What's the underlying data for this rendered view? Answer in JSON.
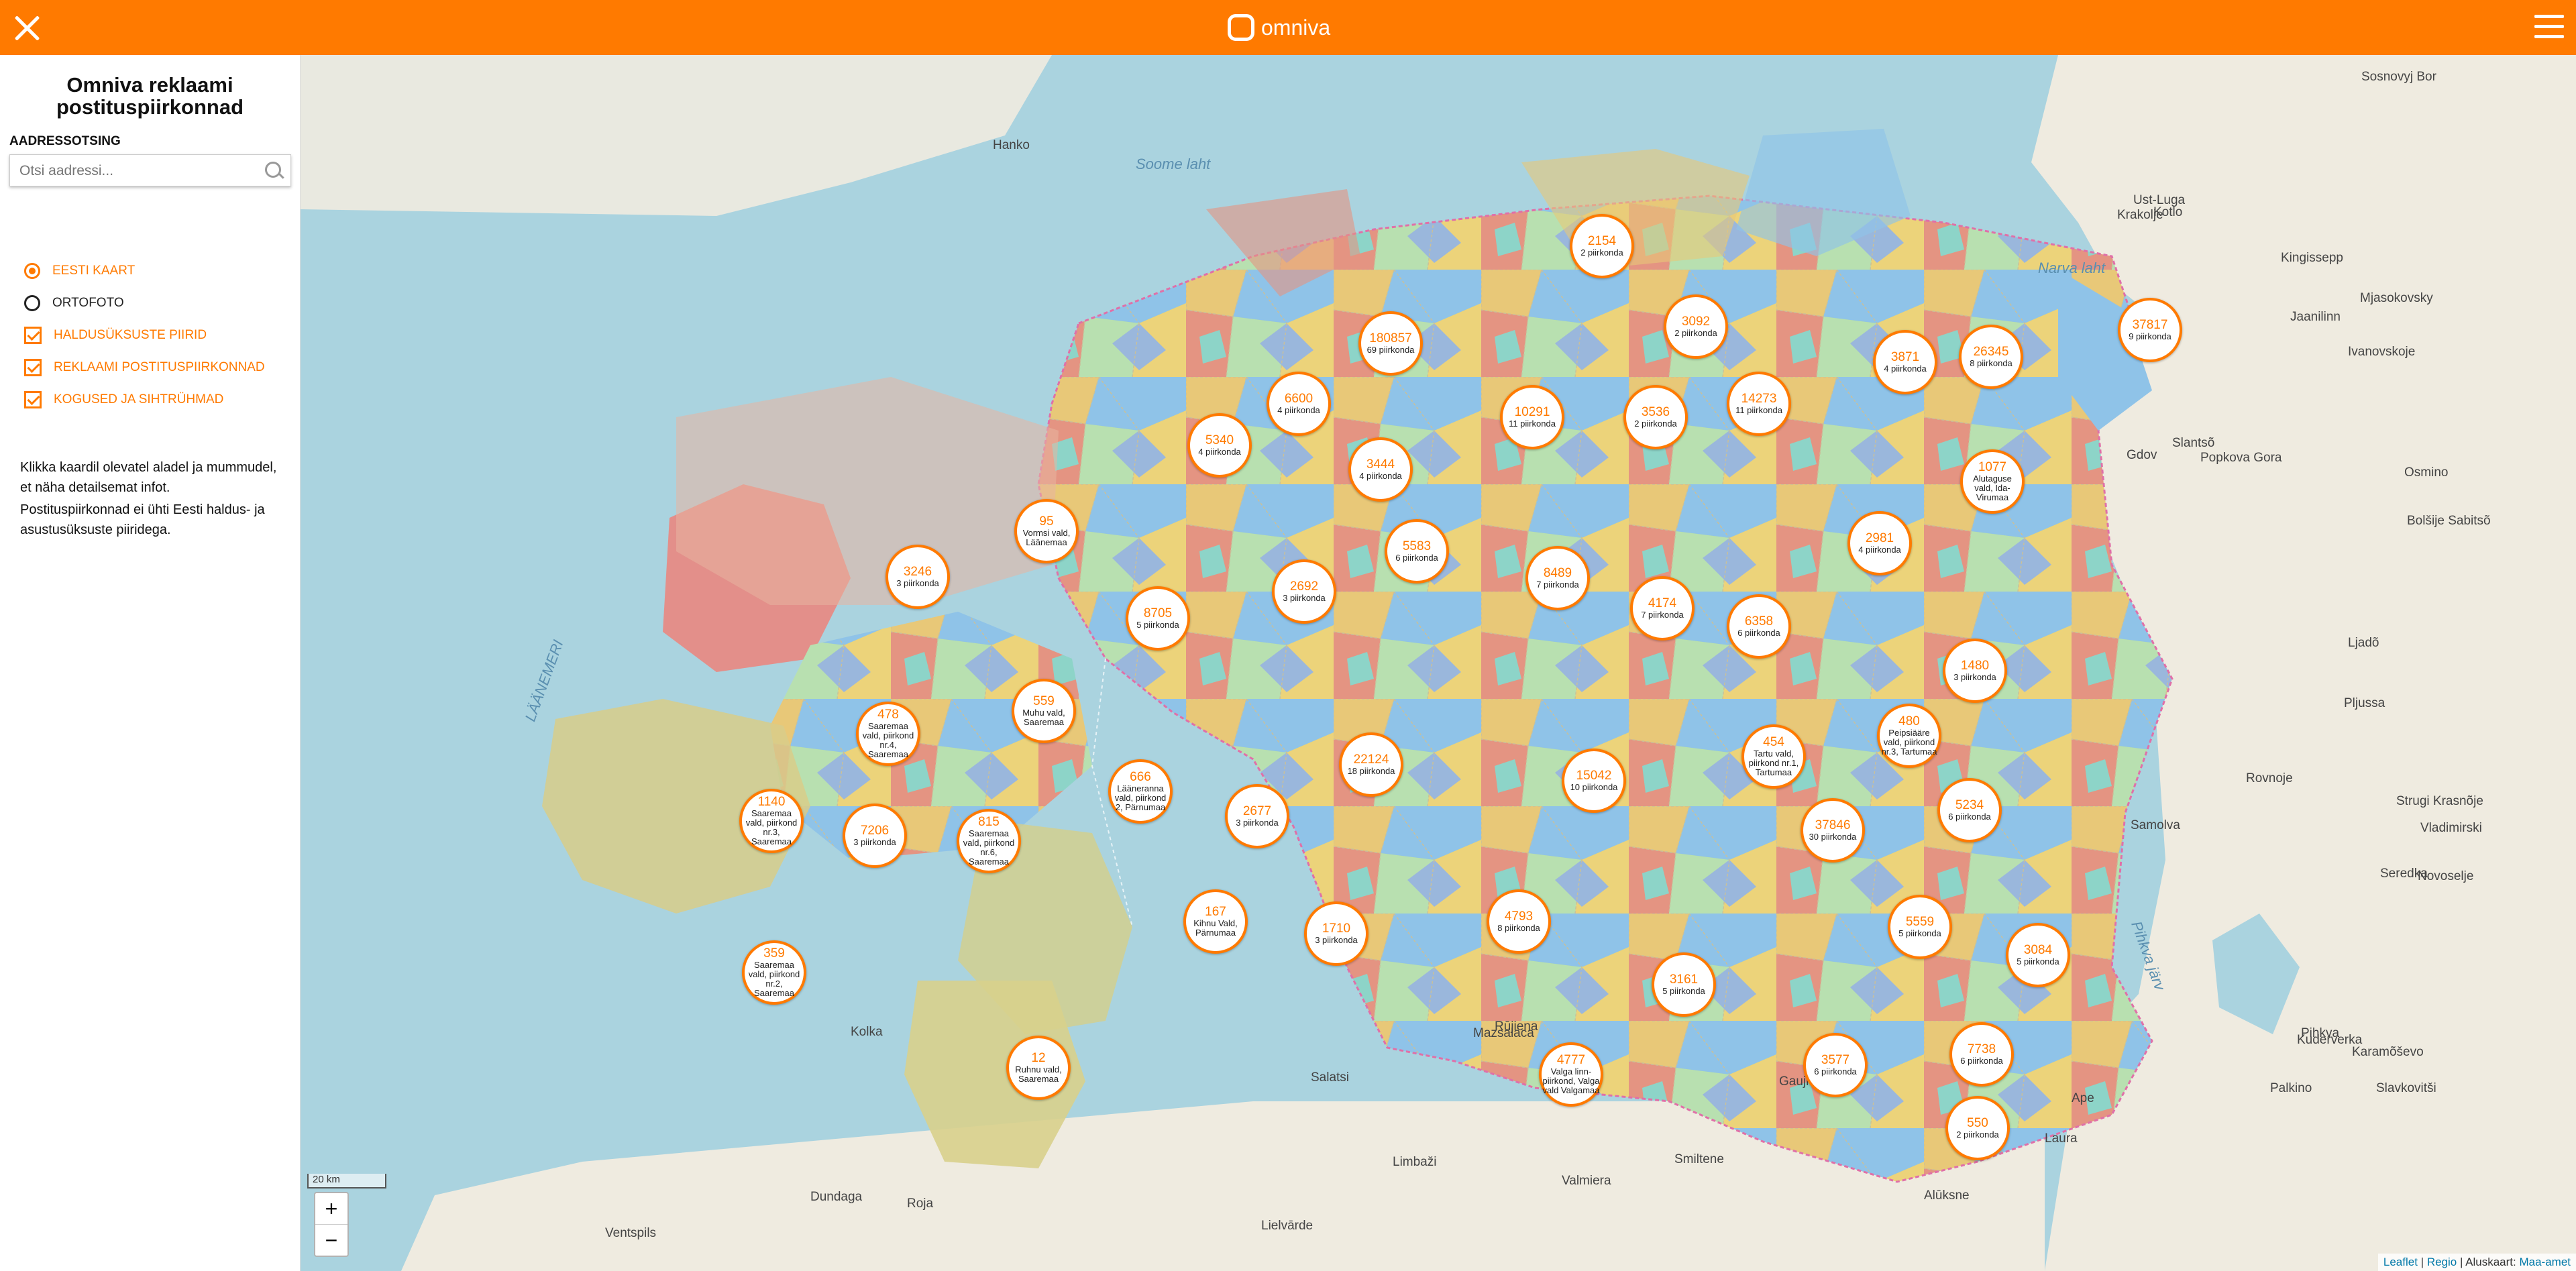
{
  "topbar": {
    "brand": "omniva",
    "accent": "#ff7a00",
    "close_icon": "close-icon",
    "menu_icon": "hamburger-menu-icon"
  },
  "sidebar": {
    "title": "Omniva reklaami postituspiirkonnad",
    "search_label": "AADRESSOTSING",
    "search_placeholder": "Otsi aadressi...",
    "options": [
      {
        "label": "EESTI KAART",
        "type": "radio",
        "checked": true
      },
      {
        "label": "ORTOFOTO",
        "type": "radio",
        "checked": false
      },
      {
        "label": "HALDUSÜKSUSTE PIIRID",
        "type": "checkbox",
        "checked": true
      },
      {
        "label": "REKLAAMI POSTITUSPIIRKONNAD",
        "type": "checkbox",
        "checked": true
      },
      {
        "label": "KOGUSED JA SIHTRÜHMAD",
        "type": "checkbox",
        "checked": true
      }
    ],
    "info1": "Klikka kaardil olevatel aladel ja mummudel, et näha detailsemat infot.",
    "info2": "Postituspiirkonnad ei ühti Eesti haldus- ja asustusüksuste piiridega."
  },
  "map": {
    "markers": [
      {
        "count": "2154",
        "label": "2 piirkonda"
      },
      {
        "count": "180857",
        "label": "69 piirkonda"
      },
      {
        "count": "3092",
        "label": "2 piirkonda"
      },
      {
        "count": "3871",
        "label": "4 piirkonda"
      },
      {
        "count": "26345",
        "label": "8 piirkonda"
      },
      {
        "count": "37817",
        "label": "9 piirkonda"
      },
      {
        "count": "6600",
        "label": "4 piirkonda"
      },
      {
        "count": "10291",
        "label": "11 piirkonda"
      },
      {
        "count": "3536",
        "label": "2 piirkonda"
      },
      {
        "count": "14273",
        "label": "11 piirkonda"
      },
      {
        "count": "5340",
        "label": "4 piirkonda"
      },
      {
        "count": "3444",
        "label": "4 piirkonda"
      },
      {
        "count": "1077",
        "label": "Alutaguse vald, Ida-Virumaa"
      },
      {
        "count": "95",
        "label": "Vormsi vald, Läänemaa"
      },
      {
        "count": "5583",
        "label": "6 piirkonda"
      },
      {
        "count": "2981",
        "label": "4 piirkonda"
      },
      {
        "count": "3246",
        "label": "3 piirkonda"
      },
      {
        "count": "8489",
        "label": "7 piirkonda"
      },
      {
        "count": "2692",
        "label": "3 piirkonda"
      },
      {
        "count": "4174",
        "label": "7 piirkonda"
      },
      {
        "count": "8705",
        "label": "5 piirkonda"
      },
      {
        "count": "6358",
        "label": "6 piirkonda"
      },
      {
        "count": "1480",
        "label": "3 piirkonda"
      },
      {
        "count": "559",
        "label": "Muhu vald, Saaremaa"
      },
      {
        "count": "478",
        "label": "Saaremaa vald, piirkond nr.4, Saaremaa"
      },
      {
        "count": "480",
        "label": "Peipsiääre vald, piirkond nr.3, Tartumaa"
      },
      {
        "count": "454",
        "label": "Tartu vald, piirkond nr.1, Tartumaa"
      },
      {
        "count": "22124",
        "label": "18 piirkonda"
      },
      {
        "count": "666",
        "label": "Lääneranna vald, piirkond 2, Pärnumaa"
      },
      {
        "count": "15042",
        "label": "10 piirkonda"
      },
      {
        "count": "1140",
        "label": "Saaremaa vald, piirkond nr.3, Saaremaa"
      },
      {
        "count": "2677",
        "label": "3 piirkonda"
      },
      {
        "count": "5234",
        "label": "6 piirkonda"
      },
      {
        "count": "7206",
        "label": "3 piirkonda"
      },
      {
        "count": "815",
        "label": "Saaremaa vald, piirkond nr.6, Saaremaa"
      },
      {
        "count": "37846",
        "label": "30 piirkonda"
      },
      {
        "count": "167",
        "label": "Kihnu Vald, Pärnumaa"
      },
      {
        "count": "4793",
        "label": "8 piirkonda"
      },
      {
        "count": "5559",
        "label": "5 piirkonda"
      },
      {
        "count": "1710",
        "label": "3 piirkonda"
      },
      {
        "count": "3084",
        "label": "5 piirkonda"
      },
      {
        "count": "359",
        "label": "Saaremaa vald, piirkond nr.2, Saaremaa"
      },
      {
        "count": "3161",
        "label": "5 piirkonda"
      },
      {
        "count": "12",
        "label": "Ruhnu vald, Saaremaa"
      },
      {
        "count": "7738",
        "label": "6 piirkonda"
      },
      {
        "count": "4777",
        "label": "Valga linn-piirkond, Valga vald Valgamaa"
      },
      {
        "count": "3577",
        "label": "6 piirkonda"
      },
      {
        "count": "550",
        "label": "2 piirkonda"
      }
    ],
    "places": [
      {
        "name": "Hanko"
      },
      {
        "name": "Sosnovyj Bor"
      },
      {
        "name": "Kotlo"
      },
      {
        "name": "Ust-Luga"
      },
      {
        "name": "Krakolje"
      },
      {
        "name": "Jaanilinn"
      },
      {
        "name": "Kingissepp"
      },
      {
        "name": "Mjasokovsky"
      },
      {
        "name": "Ivanovskoje"
      },
      {
        "name": "Slantsõ"
      },
      {
        "name": "Popkova Gora"
      },
      {
        "name": "Gdov"
      },
      {
        "name": "Osmino"
      },
      {
        "name": "Bolšije Sabitsõ"
      },
      {
        "name": "Ljadõ"
      },
      {
        "name": "Pljussa"
      },
      {
        "name": "Strugi Krasnõje"
      },
      {
        "name": "Vladimirski"
      },
      {
        "name": "Seredka"
      },
      {
        "name": "Novoselje"
      },
      {
        "name": "Samolva"
      },
      {
        "name": "Rovnoje"
      },
      {
        "name": "Kuderverka"
      },
      {
        "name": "Pihkva"
      },
      {
        "name": "Karamõševo"
      },
      {
        "name": "Palkino"
      },
      {
        "name": "Slavkovitši"
      },
      {
        "name": "Salatsi"
      },
      {
        "name": "Mazsalaca"
      },
      {
        "name": "Rūjiena"
      },
      {
        "name": "Limbaži"
      },
      {
        "name": "Valmiera"
      },
      {
        "name": "Smiltene"
      },
      {
        "name": "Alūksne"
      },
      {
        "name": "Laura"
      },
      {
        "name": "Gaujiena"
      },
      {
        "name": "Dundaga"
      },
      {
        "name": "Roja"
      },
      {
        "name": "Ventspils"
      },
      {
        "name": "Kolka"
      },
      {
        "name": "Ape"
      },
      {
        "name": "Lielvārde"
      }
    ],
    "seas": [
      {
        "name": "Soome laht"
      },
      {
        "name": "Narva laht"
      },
      {
        "name": "Pihkva järv"
      },
      {
        "name": "LÄÄNEMERI"
      }
    ],
    "scale": "20 km",
    "zoom_in": "+",
    "zoom_out": "−",
    "attribution": {
      "leaflet": "Leaflet",
      "sep1": " | ",
      "regio": "Regio",
      "rest": " | Aluskaart: ",
      "maa": "Maa-amet"
    }
  }
}
